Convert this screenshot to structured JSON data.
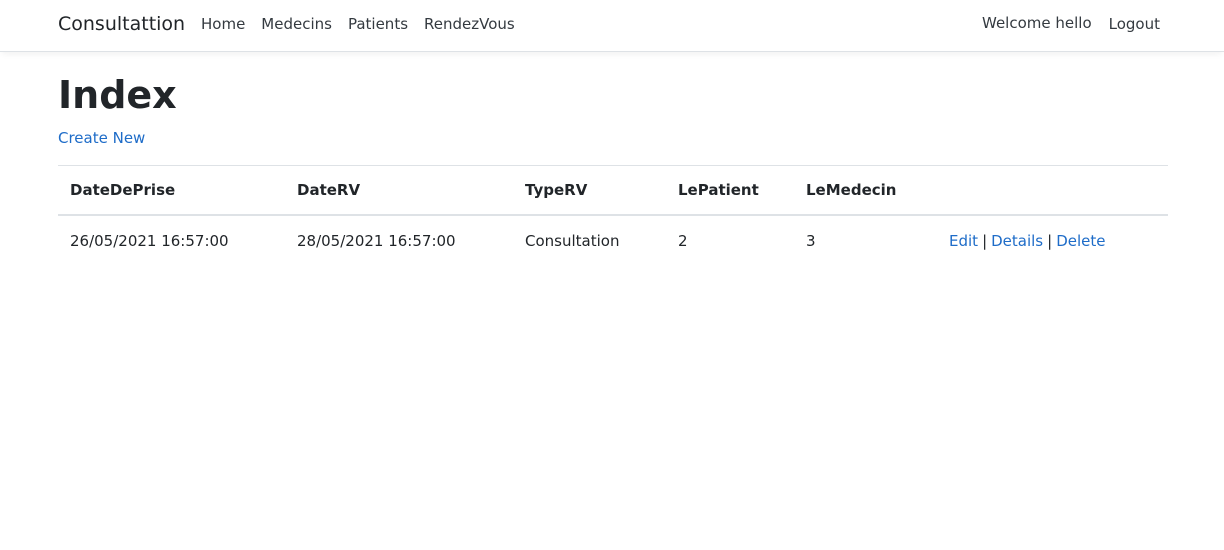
{
  "nav": {
    "brand": "Consultattion",
    "links": [
      "Home",
      "Medecins",
      "Patients",
      "RendezVous"
    ],
    "welcome": "Welcome hello",
    "logout": "Logout"
  },
  "page": {
    "title": "Index",
    "create_new": "Create New"
  },
  "table": {
    "headers": [
      "DateDePrise",
      "DateRV",
      "TypeRV",
      "LePatient",
      "LeMedecin"
    ],
    "rows": [
      {
        "date_de_prise": "26/05/2021 16:57:00",
        "date_rv": "28/05/2021 16:57:00",
        "type_rv": "Consultation",
        "le_patient": "2",
        "le_medecin": "3",
        "actions": {
          "edit": "Edit",
          "sep1": "|",
          "details": "Details",
          "sep2": "|",
          "delete": "Delete"
        }
      }
    ]
  },
  "colors": {
    "link": "#1e6cc8",
    "text": "#212529",
    "border": "#dee2e6"
  }
}
